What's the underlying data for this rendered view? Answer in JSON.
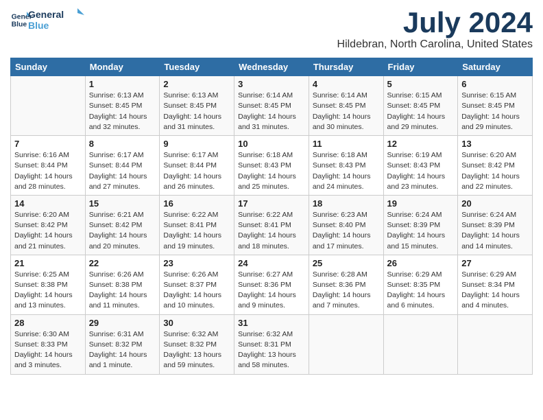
{
  "header": {
    "logo_line1": "General",
    "logo_line2": "Blue",
    "month_year": "July 2024",
    "location": "Hildebran, North Carolina, United States"
  },
  "days_of_week": [
    "Sunday",
    "Monday",
    "Tuesday",
    "Wednesday",
    "Thursday",
    "Friday",
    "Saturday"
  ],
  "weeks": [
    [
      {
        "day": "",
        "sunrise": "",
        "sunset": "",
        "daylight": ""
      },
      {
        "day": "1",
        "sunrise": "6:13 AM",
        "sunset": "8:45 PM",
        "daylight": "14 hours and 32 minutes."
      },
      {
        "day": "2",
        "sunrise": "6:13 AM",
        "sunset": "8:45 PM",
        "daylight": "14 hours and 31 minutes."
      },
      {
        "day": "3",
        "sunrise": "6:14 AM",
        "sunset": "8:45 PM",
        "daylight": "14 hours and 31 minutes."
      },
      {
        "day": "4",
        "sunrise": "6:14 AM",
        "sunset": "8:45 PM",
        "daylight": "14 hours and 30 minutes."
      },
      {
        "day": "5",
        "sunrise": "6:15 AM",
        "sunset": "8:45 PM",
        "daylight": "14 hours and 29 minutes."
      },
      {
        "day": "6",
        "sunrise": "6:15 AM",
        "sunset": "8:45 PM",
        "daylight": "14 hours and 29 minutes."
      }
    ],
    [
      {
        "day": "7",
        "sunrise": "6:16 AM",
        "sunset": "8:44 PM",
        "daylight": "14 hours and 28 minutes."
      },
      {
        "day": "8",
        "sunrise": "6:17 AM",
        "sunset": "8:44 PM",
        "daylight": "14 hours and 27 minutes."
      },
      {
        "day": "9",
        "sunrise": "6:17 AM",
        "sunset": "8:44 PM",
        "daylight": "14 hours and 26 minutes."
      },
      {
        "day": "10",
        "sunrise": "6:18 AM",
        "sunset": "8:43 PM",
        "daylight": "14 hours and 25 minutes."
      },
      {
        "day": "11",
        "sunrise": "6:18 AM",
        "sunset": "8:43 PM",
        "daylight": "14 hours and 24 minutes."
      },
      {
        "day": "12",
        "sunrise": "6:19 AM",
        "sunset": "8:43 PM",
        "daylight": "14 hours and 23 minutes."
      },
      {
        "day": "13",
        "sunrise": "6:20 AM",
        "sunset": "8:42 PM",
        "daylight": "14 hours and 22 minutes."
      }
    ],
    [
      {
        "day": "14",
        "sunrise": "6:20 AM",
        "sunset": "8:42 PM",
        "daylight": "14 hours and 21 minutes."
      },
      {
        "day": "15",
        "sunrise": "6:21 AM",
        "sunset": "8:42 PM",
        "daylight": "14 hours and 20 minutes."
      },
      {
        "day": "16",
        "sunrise": "6:22 AM",
        "sunset": "8:41 PM",
        "daylight": "14 hours and 19 minutes."
      },
      {
        "day": "17",
        "sunrise": "6:22 AM",
        "sunset": "8:41 PM",
        "daylight": "14 hours and 18 minutes."
      },
      {
        "day": "18",
        "sunrise": "6:23 AM",
        "sunset": "8:40 PM",
        "daylight": "14 hours and 17 minutes."
      },
      {
        "day": "19",
        "sunrise": "6:24 AM",
        "sunset": "8:39 PM",
        "daylight": "14 hours and 15 minutes."
      },
      {
        "day": "20",
        "sunrise": "6:24 AM",
        "sunset": "8:39 PM",
        "daylight": "14 hours and 14 minutes."
      }
    ],
    [
      {
        "day": "21",
        "sunrise": "6:25 AM",
        "sunset": "8:38 PM",
        "daylight": "14 hours and 13 minutes."
      },
      {
        "day": "22",
        "sunrise": "6:26 AM",
        "sunset": "8:38 PM",
        "daylight": "14 hours and 11 minutes."
      },
      {
        "day": "23",
        "sunrise": "6:26 AM",
        "sunset": "8:37 PM",
        "daylight": "14 hours and 10 minutes."
      },
      {
        "day": "24",
        "sunrise": "6:27 AM",
        "sunset": "8:36 PM",
        "daylight": "14 hours and 9 minutes."
      },
      {
        "day": "25",
        "sunrise": "6:28 AM",
        "sunset": "8:36 PM",
        "daylight": "14 hours and 7 minutes."
      },
      {
        "day": "26",
        "sunrise": "6:29 AM",
        "sunset": "8:35 PM",
        "daylight": "14 hours and 6 minutes."
      },
      {
        "day": "27",
        "sunrise": "6:29 AM",
        "sunset": "8:34 PM",
        "daylight": "14 hours and 4 minutes."
      }
    ],
    [
      {
        "day": "28",
        "sunrise": "6:30 AM",
        "sunset": "8:33 PM",
        "daylight": "14 hours and 3 minutes."
      },
      {
        "day": "29",
        "sunrise": "6:31 AM",
        "sunset": "8:32 PM",
        "daylight": "14 hours and 1 minute."
      },
      {
        "day": "30",
        "sunrise": "6:32 AM",
        "sunset": "8:32 PM",
        "daylight": "13 hours and 59 minutes."
      },
      {
        "day": "31",
        "sunrise": "6:32 AM",
        "sunset": "8:31 PM",
        "daylight": "13 hours and 58 minutes."
      },
      {
        "day": "",
        "sunrise": "",
        "sunset": "",
        "daylight": ""
      },
      {
        "day": "",
        "sunrise": "",
        "sunset": "",
        "daylight": ""
      },
      {
        "day": "",
        "sunrise": "",
        "sunset": "",
        "daylight": ""
      }
    ]
  ],
  "label_sunrise": "Sunrise:",
  "label_sunset": "Sunset:",
  "label_daylight": "Daylight:"
}
